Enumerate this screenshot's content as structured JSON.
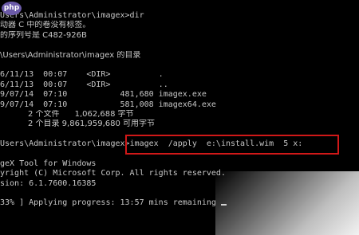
{
  "watermark": {
    "text": "php"
  },
  "terminal": {
    "line_cmd_dir": "Users\\Administrator\\imagex>dir",
    "line_volume_label": "动器 C 中的卷没有标签。",
    "line_volume_serial": "的序列号是 C482-926B",
    "line_dir_of": "\\Users\\Administrator\\imagex 的目录",
    "entries": [
      "6/11/13  00:07    <DIR>          .",
      "6/11/13  00:07    <DIR>          ..",
      "9/07/14  07:10           481,680 imagex.exe",
      "9/07/14  07:10           581,008 imagex64.exe"
    ],
    "summary_files": "           2 个文件      1,062,688 字节",
    "summary_dirs": "           2 个目录 9,861,959,680 可用字节",
    "prompt": "Users\\Administrator\\imagex>",
    "command": "imagex  /apply  e:\\install.wim  5 x:",
    "tool_name": "geX Tool for Windows",
    "copyright": "yright (C) Microsoft Corp. All rights reserved.",
    "version": "sion: 6.1.7600.16385",
    "progress": "33% ] Applying progress: 13:57 mins remaining"
  },
  "colors": {
    "background": "#000000",
    "text": "#c7c7c7",
    "highlight_border": "#d01818",
    "watermark_bg": "#6b5aa8"
  }
}
